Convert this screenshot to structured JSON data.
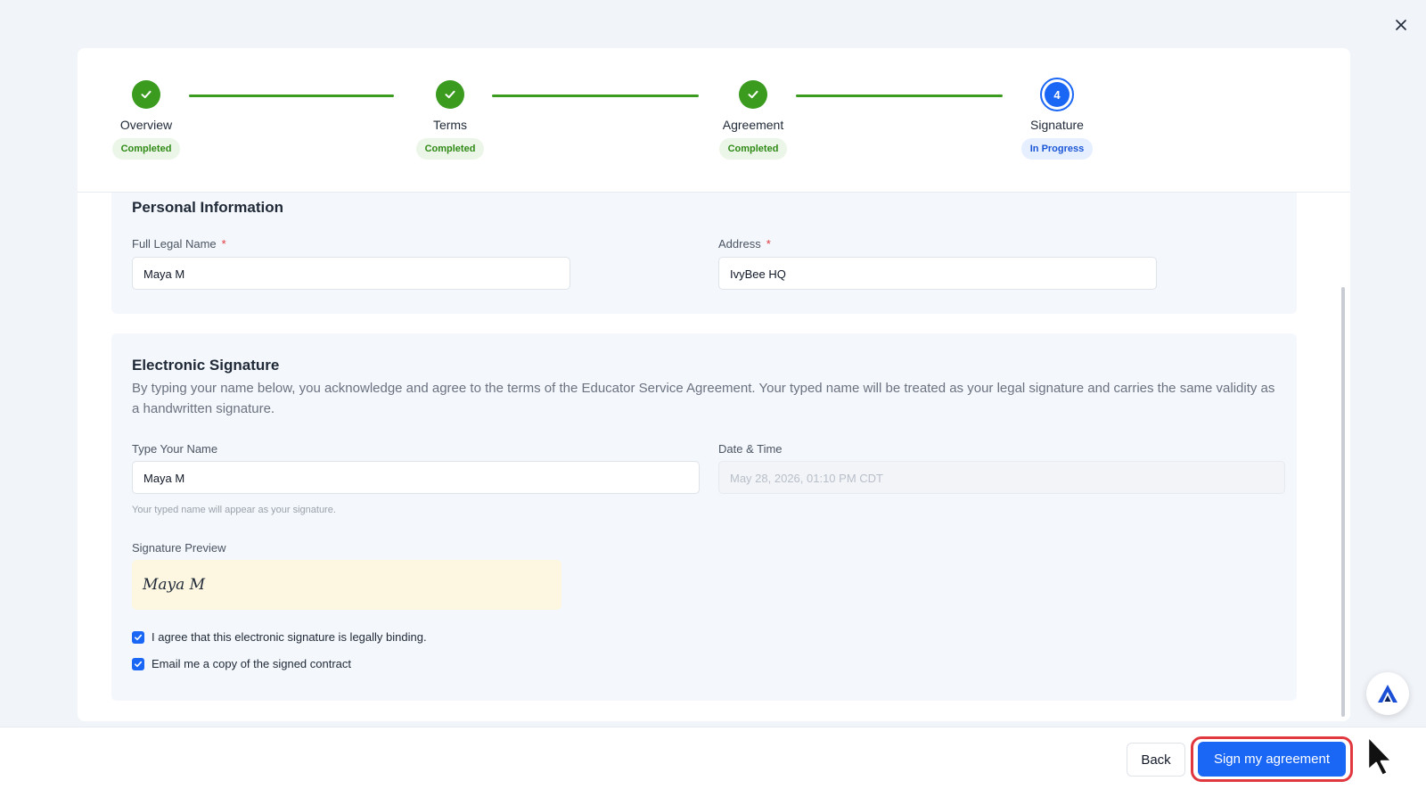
{
  "stepper": {
    "steps": [
      {
        "label": "Overview",
        "status": "Completed"
      },
      {
        "label": "Terms",
        "status": "Completed"
      },
      {
        "label": "Agreement",
        "status": "Completed"
      },
      {
        "label": "Signature",
        "status": "In Progress",
        "number": "4"
      }
    ]
  },
  "personal": {
    "title": "Personal Information",
    "name_label": "Full Legal Name",
    "name_value": "Maya M",
    "address_label": "Address",
    "address_value": "IvyBee HQ",
    "required_mark": "*"
  },
  "signature": {
    "title": "Electronic Signature",
    "description": "By typing your name below, you acknowledge and agree to the terms of the Educator Service Agreement. Your typed name will be treated as your legal signature and carries the same validity as a handwritten signature.",
    "type_label": "Type Your Name",
    "type_value": "Maya M",
    "type_hint": "Your typed name will appear as your signature.",
    "datetime_label": "Date & Time",
    "datetime_value": "May 28, 2026, 01:10 PM CDT",
    "preview_label": "Signature Preview",
    "preview_text": "Maya M",
    "agree_label": "I agree that this electronic signature is legally binding.",
    "agree_checked": true,
    "email_label": "Email me a copy of the signed contract",
    "email_checked": true
  },
  "footer": {
    "back_label": "Back",
    "sign_label": "Sign my agreement"
  },
  "colors": {
    "primary": "#1a66f5",
    "success": "#3a9b1f",
    "highlight": "#e0383e"
  },
  "icons": [
    "close-icon",
    "check-icon",
    "checkbox-check-icon",
    "assistant-logo-icon",
    "mouse-pointer-icon"
  ]
}
